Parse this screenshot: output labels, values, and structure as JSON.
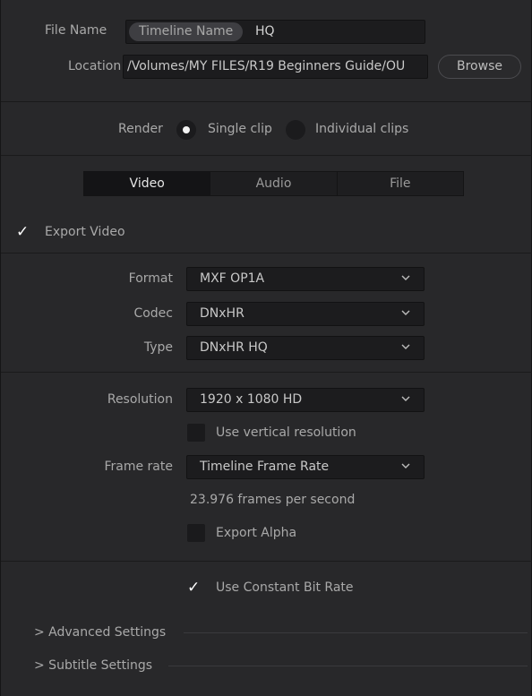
{
  "file": {
    "name_label": "File Name",
    "name_token": "Timeline Name",
    "name_suffix": "HQ",
    "location_label": "Location",
    "location_value": "/Volumes/MY FILES/R19 Beginners Guide/OU",
    "browse_label": "Browse"
  },
  "render": {
    "label": "Render",
    "options": [
      {
        "label": "Single clip",
        "selected": true
      },
      {
        "label": "Individual clips",
        "selected": false
      }
    ]
  },
  "tabs": [
    {
      "label": "Video",
      "active": true
    },
    {
      "label": "Audio",
      "active": false
    },
    {
      "label": "File",
      "active": false
    }
  ],
  "export_video": {
    "label": "Export Video",
    "checked": true
  },
  "format": {
    "label": "Format",
    "value": "MXF OP1A"
  },
  "codec": {
    "label": "Codec",
    "value": "DNxHR"
  },
  "type": {
    "label": "Type",
    "value": "DNxHR HQ"
  },
  "resolution": {
    "label": "Resolution",
    "value": "1920 x 1080 HD"
  },
  "vertical_resolution": {
    "label": "Use vertical resolution",
    "checked": false
  },
  "frame_rate": {
    "label": "Frame rate",
    "value": "Timeline Frame Rate",
    "note": "23.976 frames per second"
  },
  "export_alpha": {
    "label": "Export Alpha",
    "checked": false
  },
  "constant_bit_rate": {
    "label": "Use Constant Bit Rate",
    "checked": true
  },
  "sections": {
    "advanced": "> Advanced Settings",
    "subtitle": "> Subtitle Settings"
  },
  "colors": {
    "background": "#28282a",
    "field": "#1c1c1e",
    "text": "#a9a9a9",
    "value_text": "#c8c8c8"
  }
}
